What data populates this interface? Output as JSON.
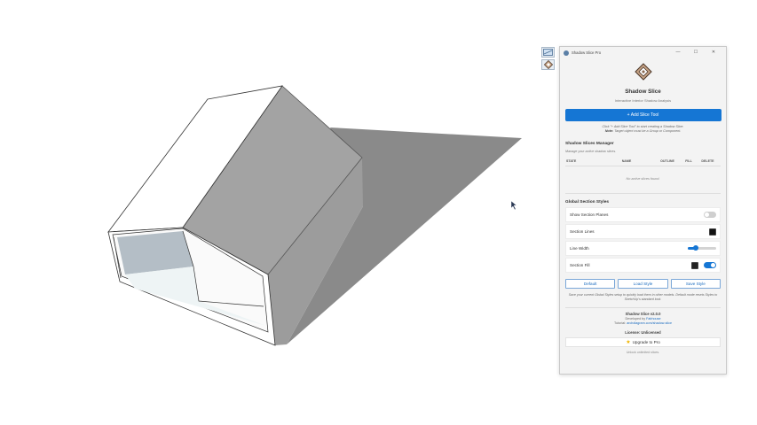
{
  "window": {
    "title": "Shadow Slice Pro",
    "minimize": "—",
    "maximize": "☐",
    "close": "✕"
  },
  "header": {
    "title": "Shadow Slice",
    "subtitle": "Interactive Interior Shadow Analysis"
  },
  "add_button": {
    "label": "+ Add Slice Tool"
  },
  "hint": {
    "line1": "Click \"+ Add Slice Tool\" to start creating a Shadow Slice.",
    "note_label": "Note:",
    "note_text": "Target object must be a Group or Component."
  },
  "manager": {
    "title": "Shadow Slices Manager",
    "subtitle": "Manage your active shadow slices.",
    "columns": [
      "STATE",
      "NAME",
      "OUTLINE",
      "FILL",
      "DELETE"
    ],
    "empty": "No active slices found."
  },
  "styles": {
    "title": "Global Section Styles",
    "show_planes": {
      "label": "Show Section Planes",
      "on": false
    },
    "section_lines": {
      "label": "Section Lines",
      "color": "#111111"
    },
    "line_width": {
      "label": "Line Width",
      "value": 0.28
    },
    "section_fill": {
      "label": "Section Fill",
      "color": "#222222",
      "on": true
    },
    "buttons": {
      "default": "Default",
      "load": "Load Style",
      "save": "Save Style"
    },
    "note": "Save your current Global Styles setup to quickly load them in other models. Default mode resets Styles to SketchUp's standard look."
  },
  "about": {
    "version": "Shadow Slice v2.0.0",
    "dev_prefix": "Developed by",
    "dev_name": "Fabhouse",
    "tutorial_prefix": "Tutorial:",
    "tutorial_link": "archdiagram.com/shadow-slice"
  },
  "license": {
    "status": "License: Unlicensed",
    "upgrade": "Upgrade to Pro",
    "unlock": "Unlock unlimited slices."
  },
  "colors": {
    "accent": "#1576d4",
    "shadow": "#8a8a8a",
    "roof": "#a2a2a2",
    "wall_side": "#9a9a9a"
  }
}
